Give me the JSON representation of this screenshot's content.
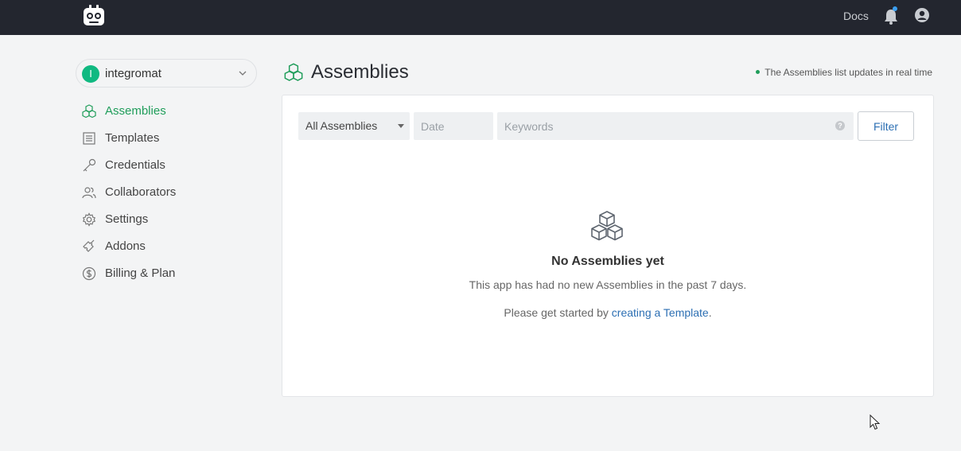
{
  "topbar": {
    "logo_icon": "robot-logo-icon",
    "docs_label": "Docs",
    "notification_icon": "bell-icon",
    "notification_dot_color": "#3b9ff0",
    "user_icon": "user-circle-icon"
  },
  "workspace": {
    "avatar_letter": "I",
    "name": "integromat",
    "avatar_color": "#10b981"
  },
  "sidebar": {
    "items": [
      {
        "label": "Assemblies",
        "icon": "cubes-icon",
        "active": true
      },
      {
        "label": "Templates",
        "icon": "list-icon",
        "active": false
      },
      {
        "label": "Credentials",
        "icon": "key-icon",
        "active": false
      },
      {
        "label": "Collaborators",
        "icon": "users-icon",
        "active": false
      },
      {
        "label": "Settings",
        "icon": "gear-icon",
        "active": false
      },
      {
        "label": "Addons",
        "icon": "puzzle-icon",
        "active": false
      },
      {
        "label": "Billing & Plan",
        "icon": "dollar-icon",
        "active": false
      }
    ]
  },
  "main": {
    "title": "Assemblies",
    "realtime_note": "The Assemblies list updates in real time",
    "accent_color": "#1f9d5a",
    "filters": {
      "type_selected": "All Assemblies",
      "date_placeholder": "Date",
      "keywords_placeholder": "Keywords",
      "help_glyph": "?",
      "filter_label": "Filter"
    },
    "empty": {
      "title": "No Assemblies yet",
      "description": "This app has had no new Assemblies in the past 7 days.",
      "cta_prefix": "Please get started by ",
      "cta_link": "creating a Template",
      "cta_suffix": "."
    }
  }
}
